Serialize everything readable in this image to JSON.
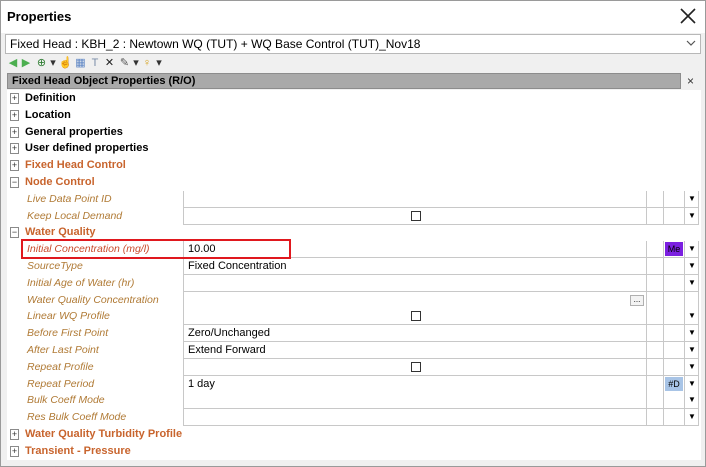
{
  "window": {
    "title": "Properties",
    "close_glyph": "×"
  },
  "selector": {
    "value": "Fixed Head : KBH_2 : Newtown WQ (TUT) + WQ Base Control (TUT)_Nov18",
    "dropdown_glyph": "⌄"
  },
  "toolbar": {
    "icons": [
      {
        "name": "back-arrow-icon",
        "glyph": "◀",
        "color": "#4caf50"
      },
      {
        "name": "forward-arrow-icon",
        "glyph": "▶",
        "color": "#4caf50"
      },
      {
        "name": "globe-icon",
        "glyph": "⊕",
        "color": "#2e7d32"
      },
      {
        "name": "globe-dropdown-icon",
        "glyph": "▾",
        "color": "#333333"
      },
      {
        "name": "pointer-hand-icon",
        "glyph": "☝",
        "color": "#1e5fbf"
      },
      {
        "name": "grid-view-icon",
        "glyph": "▦",
        "color": "#5b84c4"
      },
      {
        "name": "text-tool-icon",
        "glyph": "T",
        "color": "#7a8da8"
      },
      {
        "name": "delete-x-icon",
        "glyph": "✕",
        "color": "#222222"
      },
      {
        "name": "wrench-icon",
        "glyph": "✎",
        "color": "#555555"
      },
      {
        "name": "wrench-dropdown-icon",
        "glyph": "▾",
        "color": "#333333"
      },
      {
        "name": "lightbulb-icon",
        "glyph": "♀",
        "color": "#d4a017"
      },
      {
        "name": "lightbulb-dropdown-icon",
        "glyph": "▾",
        "color": "#333333"
      }
    ]
  },
  "panel": {
    "header": "Fixed Head Object Properties (R/O)",
    "close_glyph": "×"
  },
  "grid": {
    "rows": [
      {
        "type": "group",
        "label": "Definition",
        "expander": "+",
        "color": "#000000"
      },
      {
        "type": "group",
        "label": "Location",
        "expander": "+",
        "color": "#000000"
      },
      {
        "type": "group",
        "label": "General properties",
        "expander": "+",
        "color": "#000000"
      },
      {
        "type": "group",
        "label": "User defined properties",
        "expander": "+",
        "color": "#000000"
      },
      {
        "type": "group",
        "label": "Fixed Head Control",
        "expander": "+",
        "color": "#c8642d"
      },
      {
        "type": "group",
        "label": "Node Control",
        "expander": "−",
        "color": "#c8642d"
      },
      {
        "type": "prop",
        "label": "Live Data Point ID",
        "value": "",
        "dropdown": true
      },
      {
        "type": "prop",
        "label": "Keep Local Demand",
        "checkbox": true,
        "dropdown": true
      },
      {
        "type": "group",
        "label": "Water Quality",
        "expander": "−",
        "color": "#c8642d"
      },
      {
        "type": "prop",
        "label": "Initial  Concentration (mg/l)",
        "value": "10.00",
        "tag": "Me",
        "tag_color": "#7b1fe0",
        "dropdown": true,
        "highlight": true
      },
      {
        "type": "prop",
        "label": "SourceType",
        "value": "Fixed Concentration",
        "dropdown": true
      },
      {
        "type": "prop",
        "label": "Initial Age of Water (hr)",
        "value": "",
        "dropdown": true
      },
      {
        "type": "prop",
        "label": "Water Quality Concentration",
        "value": "",
        "ellipsis": "...",
        "dropdown": false
      },
      {
        "type": "prop",
        "label": "Linear WQ Profile",
        "checkbox": true,
        "dropdown": true
      },
      {
        "type": "prop",
        "label": "Before First Point",
        "value": "Zero/Unchanged",
        "dropdown": true
      },
      {
        "type": "prop",
        "label": "After Last Point",
        "value": "Extend Forward",
        "dropdown": true
      },
      {
        "type": "prop",
        "label": "Repeat Profile",
        "checkbox": true,
        "dropdown": true
      },
      {
        "type": "prop",
        "label": "Repeat Period",
        "value": "1 day",
        "tag": "#D",
        "tag_color": "#a8c4e6",
        "dropdown": true
      },
      {
        "type": "prop",
        "label": "Bulk Coeff Mode",
        "value": "",
        "dropdown": true
      },
      {
        "type": "prop",
        "label": "Res Bulk Coeff Mode",
        "value": "",
        "dropdown": true
      },
      {
        "type": "group",
        "label": "Water Quality Turbidity Profile",
        "expander": "+",
        "color": "#c8642d"
      },
      {
        "type": "group",
        "label": "Transient - Pressure",
        "expander": "+",
        "color": "#c8642d"
      }
    ]
  }
}
